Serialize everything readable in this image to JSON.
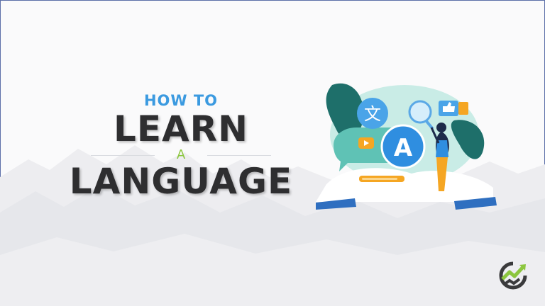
{
  "title": {
    "how_to": "HOW TO",
    "learn": "LEARN",
    "a": "A",
    "language": "LANGUAGE"
  },
  "illustration": {
    "bubble_glyph_top": "文",
    "bubble_glyph_main": "A"
  },
  "colors": {
    "how_to": "#3b9ae0",
    "heading": "#2e2e30",
    "accent_green": "#8cc63f",
    "teal": "#1e6f6a",
    "bubble_blue": "#2f8ee0",
    "orange": "#f5a623"
  },
  "icons": [
    "translate-icon",
    "play-icon",
    "magnifier-icon",
    "thumbs-up-icon",
    "brand-logo-icon"
  ]
}
